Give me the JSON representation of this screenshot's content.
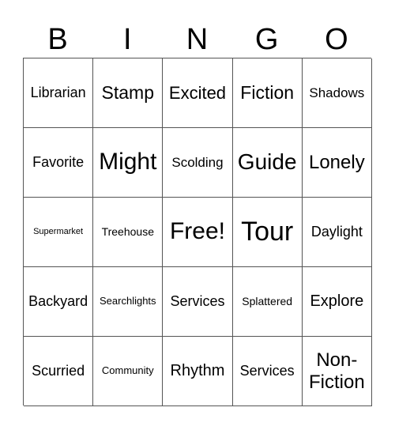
{
  "header": {
    "letters": [
      "B",
      "I",
      "N",
      "G",
      "O"
    ]
  },
  "grid": {
    "rows": [
      [
        "Librarian",
        "Stamp",
        "Excited",
        "Fiction",
        "Shadows"
      ],
      [
        "Favorite",
        "Might",
        "Scolding",
        "Guide",
        "Lonely"
      ],
      [
        "Supermarket",
        "Treehouse",
        "Free!",
        "Tour",
        "Daylight"
      ],
      [
        "Backyard",
        "Searchlights",
        "Services",
        "Splattered",
        "Explore"
      ],
      [
        "Scurried",
        "Community",
        "Rhythm",
        "Services",
        "Non-Fiction"
      ]
    ],
    "free_space": "Free!"
  }
}
